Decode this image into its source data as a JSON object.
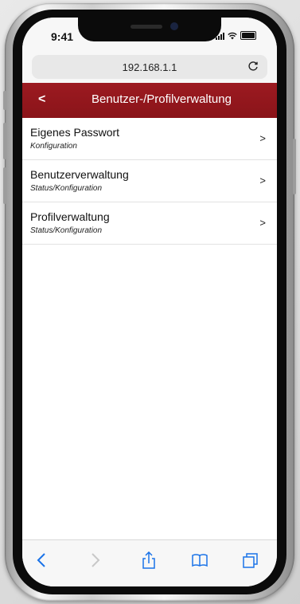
{
  "status_bar": {
    "time": "9:41"
  },
  "browser": {
    "url": "192.168.1.1"
  },
  "header": {
    "back_label": "<",
    "title": "Benutzer-/Profilverwaltung"
  },
  "menu": {
    "items": [
      {
        "title": "Eigenes Passwort",
        "subtitle": "Konfiguration",
        "chevron": ">"
      },
      {
        "title": "Benutzerverwaltung",
        "subtitle": "Status/Konfiguration",
        "chevron": ">"
      },
      {
        "title": "Profilverwaltung",
        "subtitle": "Status/Konfiguration",
        "chevron": ">"
      }
    ]
  },
  "toolbar": {
    "icons": [
      "back-icon",
      "forward-icon",
      "share-icon",
      "bookmarks-icon",
      "tabs-icon"
    ]
  },
  "colors": {
    "header_red": "#8f161c",
    "ios_blue": "#1a73e8"
  }
}
